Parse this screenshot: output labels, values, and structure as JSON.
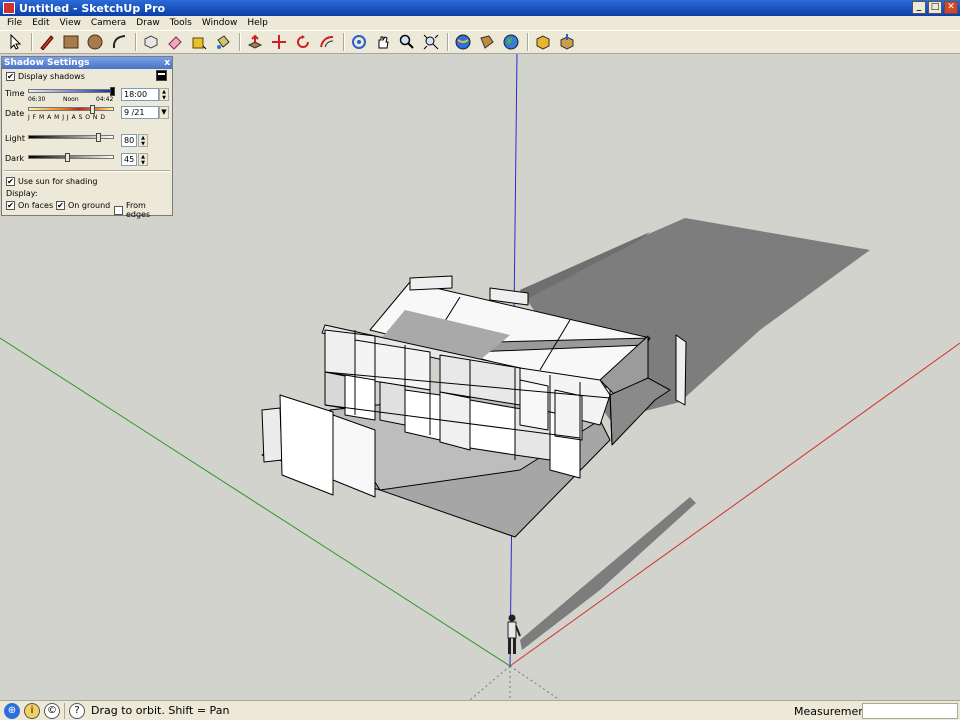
{
  "window": {
    "title": "Untitled - SketchUp Pro",
    "minimize": "_",
    "maximize": "□",
    "close": "✕"
  },
  "menu": [
    "File",
    "Edit",
    "View",
    "Camera",
    "Draw",
    "Tools",
    "Window",
    "Help"
  ],
  "toolbar": {
    "tools": [
      {
        "name": "select-tool",
        "icon": "arrow-icon"
      },
      {
        "name": "line-tool",
        "icon": "pencil-icon"
      },
      {
        "name": "rectangle-tool",
        "icon": "rectangle-icon"
      },
      {
        "name": "circle-tool",
        "icon": "circle-icon"
      },
      {
        "name": "arc-tool",
        "icon": "arc-icon"
      },
      {
        "name": "make-component-tool",
        "icon": "component-icon"
      },
      {
        "name": "eraser-tool",
        "icon": "eraser-icon"
      },
      {
        "name": "tape-measure-tool",
        "icon": "tape-icon"
      },
      {
        "name": "paint-bucket-tool",
        "icon": "paint-bucket-icon"
      },
      {
        "name": "push-pull-tool",
        "icon": "push-pull-icon"
      },
      {
        "name": "move-tool",
        "icon": "move-icon"
      },
      {
        "name": "rotate-tool",
        "icon": "rotate-icon"
      },
      {
        "name": "offset-tool",
        "icon": "offset-icon"
      },
      {
        "name": "orbit-tool",
        "icon": "orbit-icon"
      },
      {
        "name": "pan-tool",
        "icon": "hand-icon"
      },
      {
        "name": "zoom-tool",
        "icon": "magnifier-icon"
      },
      {
        "name": "zoom-extents-tool",
        "icon": "zoom-extents-icon"
      },
      {
        "name": "get-models-tool",
        "icon": "globe-icon"
      },
      {
        "name": "share-model-tool",
        "icon": "share-icon"
      },
      {
        "name": "google-earth-tool",
        "icon": "earth-icon"
      },
      {
        "name": "get-components-tool",
        "icon": "components-get-icon"
      },
      {
        "name": "share-component-tool",
        "icon": "components-share-icon"
      }
    ]
  },
  "shadow_settings": {
    "title": "Shadow Settings",
    "close": "x",
    "display_shadows_label": "Display shadows",
    "display_shadows_checked": true,
    "time_label": "Time",
    "time_start": "06:30",
    "time_mid": "Noon",
    "time_end": "04:42",
    "time_value": "18:00",
    "date_label": "Date",
    "months": "J F M A M J J A S O N D",
    "date_value": "9 /21",
    "light_label": "Light",
    "light_value": "80",
    "dark_label": "Dark",
    "dark_value": "45",
    "use_sun_label": "Use sun for shading",
    "use_sun_checked": true,
    "display_label": "Display:",
    "on_faces_label": "On faces",
    "on_faces_checked": true,
    "on_ground_label": "On ground",
    "on_ground_checked": true,
    "from_edges_label": "From edges",
    "from_edges_checked": false
  },
  "statusbar": {
    "hint": "Drag to orbit.  Shift = Pan",
    "measurements_label": "Measurements",
    "measurements_value": ""
  },
  "colors": {
    "red_axis": "#d03030",
    "green_axis": "#2a9a2a",
    "blue_axis": "#2a2ad0",
    "ground": "#d3d3cd",
    "shadow": "#7d7d7d"
  }
}
